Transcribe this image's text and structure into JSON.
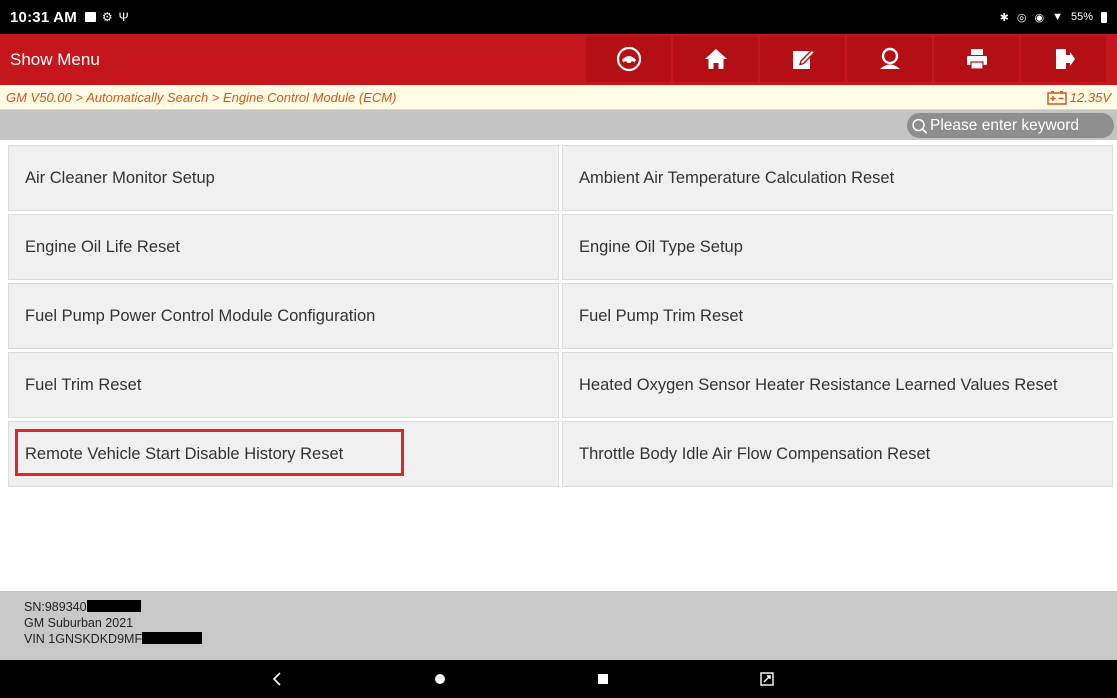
{
  "status_bar": {
    "time": "10:31 AM",
    "left_icons": [
      "gallery-icon",
      "settings-icon",
      "usb-icon"
    ],
    "right_icons": [
      "bluetooth-icon",
      "vibrate-icon",
      "location-icon",
      "wifi-icon"
    ],
    "battery": "55%"
  },
  "header": {
    "title": "Show Menu",
    "background_color": "#c5161d",
    "toolbar": [
      {
        "name": "diagnostic-icon"
      },
      {
        "name": "home-icon"
      },
      {
        "name": "edit-report-icon"
      },
      {
        "name": "user-icon"
      },
      {
        "name": "print-icon"
      },
      {
        "name": "exit-icon"
      }
    ]
  },
  "breadcrumb": {
    "path": "GM V50.00 > Automatically Search > Engine Control Module (ECM)",
    "voltage": "12.35V",
    "text_color": "#d2591b"
  },
  "search": {
    "placeholder": "Please enter keyword"
  },
  "menu_items": [
    {
      "label": "Air Cleaner Monitor Setup",
      "highlighted": false
    },
    {
      "label": "Ambient Air Temperature Calculation Reset",
      "highlighted": false
    },
    {
      "label": "Engine Oil Life Reset",
      "highlighted": false
    },
    {
      "label": "Engine Oil Type Setup",
      "highlighted": false
    },
    {
      "label": "Fuel Pump Power Control Module Configuration",
      "highlighted": false
    },
    {
      "label": "Fuel Pump Trim Reset",
      "highlighted": false
    },
    {
      "label": "Fuel Trim Reset",
      "highlighted": false
    },
    {
      "label": "Heated Oxygen Sensor Heater Resistance Learned Values Reset",
      "highlighted": false
    },
    {
      "label": "Remote Vehicle Start Disable History Reset",
      "highlighted": true
    },
    {
      "label": "Throttle Body Idle Air Flow Compensation Reset",
      "highlighted": false
    }
  ],
  "vehicle_info": {
    "sn": "SN:989340",
    "model": "GM Suburban 2021",
    "vin": "VIN 1GNSKDKD9MF"
  },
  "nav_bar": {
    "buttons": [
      "back-icon",
      "home-circle-icon",
      "recents-icon",
      "screenshot-icon"
    ]
  }
}
